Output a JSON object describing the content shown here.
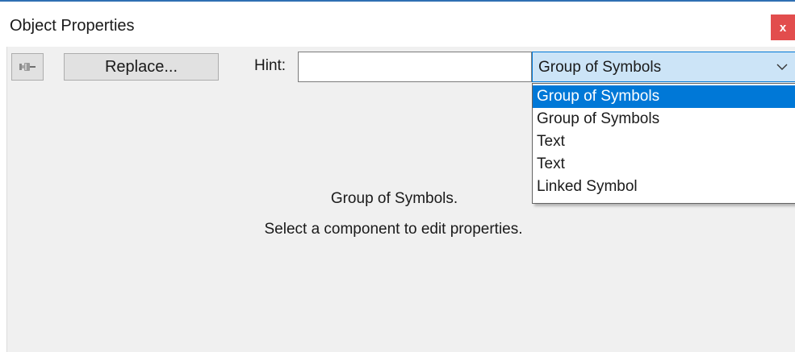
{
  "window": {
    "title": "Object Properties",
    "close_label": "x"
  },
  "toolbar": {
    "pin_icon": "pushpin-icon",
    "replace_label": "Replace...",
    "hint_label": "Hint:",
    "hint_value": "",
    "type_selected": "Group of Symbols"
  },
  "dropdown": {
    "items": [
      {
        "label": "Group of Symbols",
        "selected": true
      },
      {
        "label": "Group of Symbols",
        "selected": false
      },
      {
        "label": "Text",
        "selected": false
      },
      {
        "label": "Text",
        "selected": false
      },
      {
        "label": "Linked Symbol",
        "selected": false
      }
    ]
  },
  "main": {
    "component_name": "Group of Symbols.",
    "instruction": "Select a component to edit properties."
  },
  "colors": {
    "accent": "#0078d7",
    "close_button": "#e24d4d",
    "combo_background": "#cce4f7",
    "panel_background": "#f0f0f0"
  }
}
